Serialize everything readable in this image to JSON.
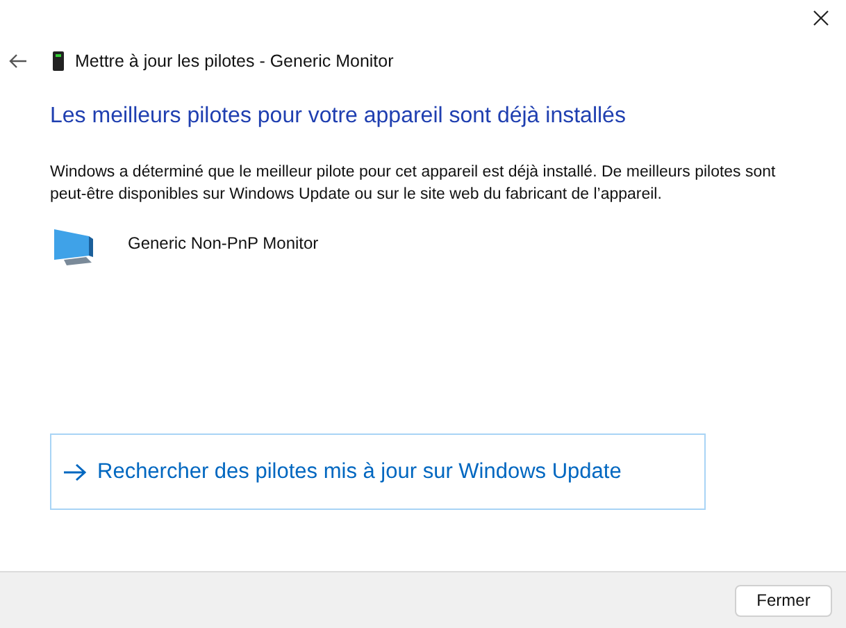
{
  "window": {
    "title": "Mettre à jour les pilotes - Generic Monitor"
  },
  "heading": "Les meilleurs pilotes pour votre appareil sont déjà installés",
  "message": "Windows a déterminé que le meilleur pilote pour cet appareil est déjà installé. De meilleurs pilotes sont peut-être disponibles sur Windows Update ou sur le site web du fabricant de l’appareil.",
  "device": {
    "name": "Generic Non-PnP Monitor"
  },
  "command_link": {
    "label": "Rechercher des pilotes mis à jour sur Windows Update",
    "focused": true
  },
  "buttons": [
    {
      "label": "Fermer"
    }
  ]
}
